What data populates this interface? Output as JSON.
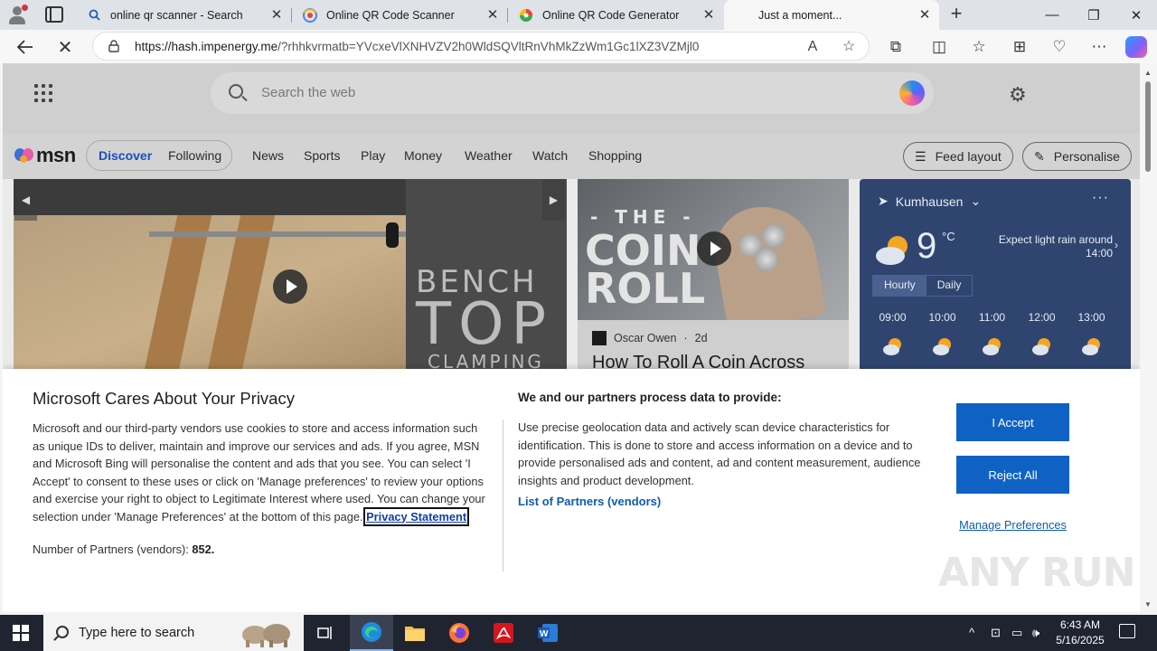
{
  "browser": {
    "tabs": [
      {
        "title": "online qr scanner - Search",
        "icon": "search-icon"
      },
      {
        "title": "Online QR Code Scanner",
        "icon": "qr-scanner-favicon"
      },
      {
        "title": "Online QR Code Generator",
        "icon": "qr-generator-favicon"
      },
      {
        "title": "Just a moment...",
        "icon": "loading-favicon",
        "active": true
      }
    ],
    "url_host": "https://hash.impenergy.me",
    "url_path": "/?rhhkvrmatb=YVcxeVlXNHVZV2h0WldSQVltRnVhMkZzWm1Gc1lXZ3VZMjl0"
  },
  "msn": {
    "search_placeholder": "Search the web",
    "logo_text": "msn",
    "pill_tabs": [
      "Discover",
      "Following"
    ],
    "nav_links": [
      "News",
      "Sports",
      "Play",
      "Money",
      "Weather",
      "Watch",
      "Shopping"
    ],
    "feed_layout_label": "Feed layout",
    "personalise_label": "Personalise",
    "hero": {
      "overlay_word1": "BENCH",
      "overlay_word2": "TOP",
      "overlay_word3": "CLAMPING"
    },
    "coin_card": {
      "image_line1": "- THE -",
      "image_line2": "COIN",
      "image_line3": "ROLL",
      "author": "Oscar Owen",
      "age": "2d",
      "title": "How To Roll A Coin Across"
    },
    "weather": {
      "location": "Kumhausen",
      "temperature": "9",
      "unit": "°C",
      "forecast_line1": "Expect light rain around",
      "forecast_line2": "14:00",
      "tab_hourly": "Hourly",
      "tab_daily": "Daily",
      "hours": [
        "09:00",
        "10:00",
        "11:00",
        "12:00",
        "13:00"
      ]
    }
  },
  "privacy": {
    "title": "Microsoft Cares About Your Privacy",
    "text": "Microsoft and our third-party vendors use cookies to store and access information such as unique IDs to deliver, maintain and improve our services and ads. If you agree, MSN and Microsoft Bing will personalise the content and ads that you see. You can select 'I Accept' to consent to these uses or click on 'Manage preferences' to review your options and exercise your right to object to Legitimate Interest where used.  You can change your selection under 'Manage Preferences' at the bottom of this page.",
    "statement_link": "Privacy Statement",
    "partners_label": "Number of Partners (vendors):",
    "partners_count": "852.",
    "right_heading": "We and our partners process data to provide:",
    "right_text": "Use precise geolocation data and actively scan device characteristics for identification. This is done to store and access information on a device and to provide personalised ads and content, ad and content measurement, audience insights and product development.",
    "vendors_link": "List of Partners (vendors)",
    "accept_label": "I Accept",
    "reject_label": "Reject All",
    "manage_label": "Manage Preferences",
    "watermark": "ANY RUN"
  },
  "taskbar": {
    "search_placeholder": "Type here to search",
    "time": "6:43 AM",
    "date": "5/16/2025"
  }
}
